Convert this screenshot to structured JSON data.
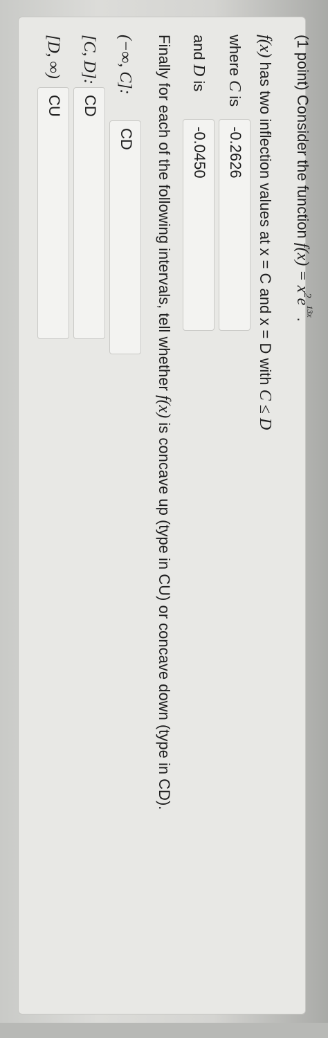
{
  "header": {
    "points": "(1 point)",
    "intro": "Consider the function",
    "func_lhs": "f(x) =",
    "func_base": "x",
    "func_exp1": "2",
    "func_e": "e",
    "func_exp2": "13x",
    "func_end": "."
  },
  "inflection": {
    "f_of_x": "f(x)",
    "text": "has two inflection values at x = C and x = D with",
    "condition": "C ≤ D",
    "c_label_pre": "where",
    "c_var": "C",
    "c_label_post": "is",
    "c_value": "-0.2626",
    "d_label_pre": "and",
    "d_var": "D",
    "d_label_post": "is",
    "d_value": "-0.0450"
  },
  "concavity": {
    "instr_pre": "Finally for each of the following intervals, tell whether",
    "f_of_x": "f(x)",
    "instr_post": "is concave up (type in CU) or concave down (type in CD).",
    "rows": [
      {
        "interval": "(−∞, C]:",
        "value": "CD"
      },
      {
        "interval": "[C, D]:",
        "value": "CD"
      },
      {
        "interval": "[D, ∞)",
        "value": "CU"
      }
    ]
  }
}
